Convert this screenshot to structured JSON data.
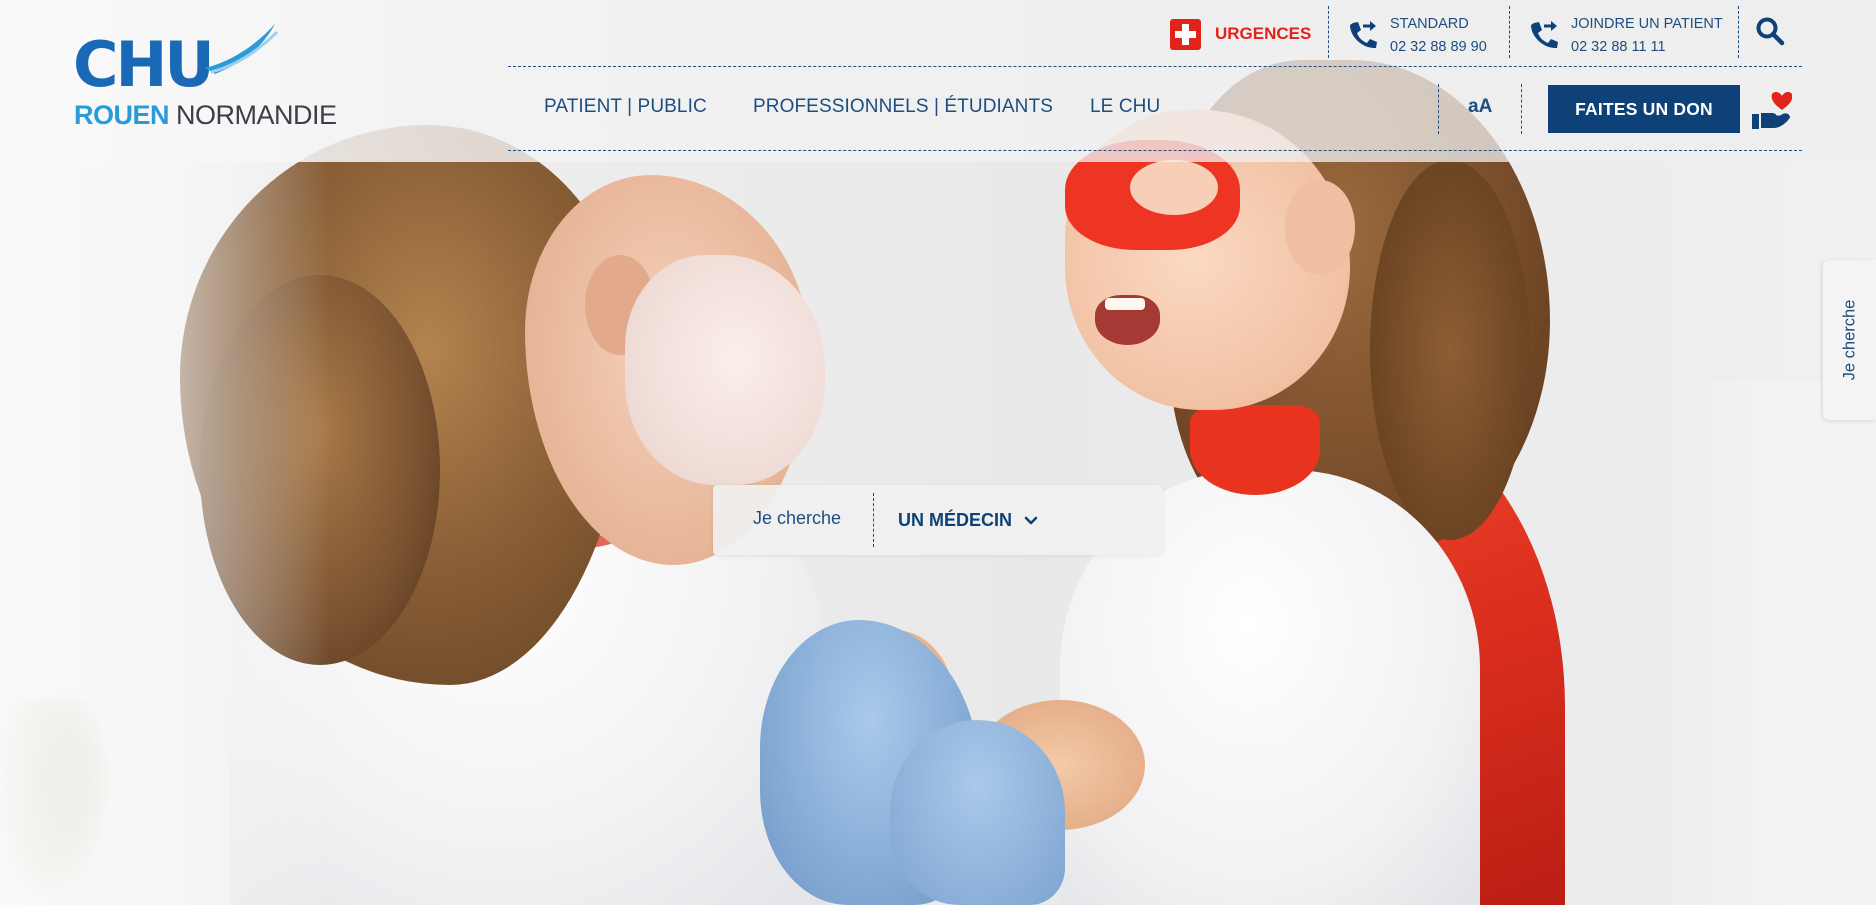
{
  "brand": {
    "logo_main": "CHU",
    "logo_city": "ROUEN",
    "logo_region": "NORMANDIE",
    "primary_color": "#1a69b6",
    "secondary_color": "#2b9bd8",
    "dark_navy": "#0d4177",
    "urgent_red": "#e2231a"
  },
  "topbar": {
    "urgences": {
      "label": "URGENCES",
      "icon": "medical-cross-icon"
    },
    "standard": {
      "title": "STANDARD",
      "phone": "02 32 88 89 90",
      "icon": "phone-forward-icon"
    },
    "joindre": {
      "title": "JOINDRE UN PATIENT",
      "phone": "02 32 88 11 11",
      "icon": "phone-forward-icon"
    },
    "search_icon": "search-icon"
  },
  "nav": {
    "items": [
      {
        "label": "PATIENT | PUBLIC"
      },
      {
        "label": "PROFESSIONNELS | ÉTUDIANTS"
      },
      {
        "label": "LE CHU"
      }
    ],
    "text_size_label": "aA",
    "donate_label": "FAITES UN DON",
    "donate_icon": "heart-hand-icon"
  },
  "finder": {
    "label": "Je cherche",
    "selected": "UN MÉDECIN"
  },
  "side_tab": {
    "label": "Je cherche"
  }
}
